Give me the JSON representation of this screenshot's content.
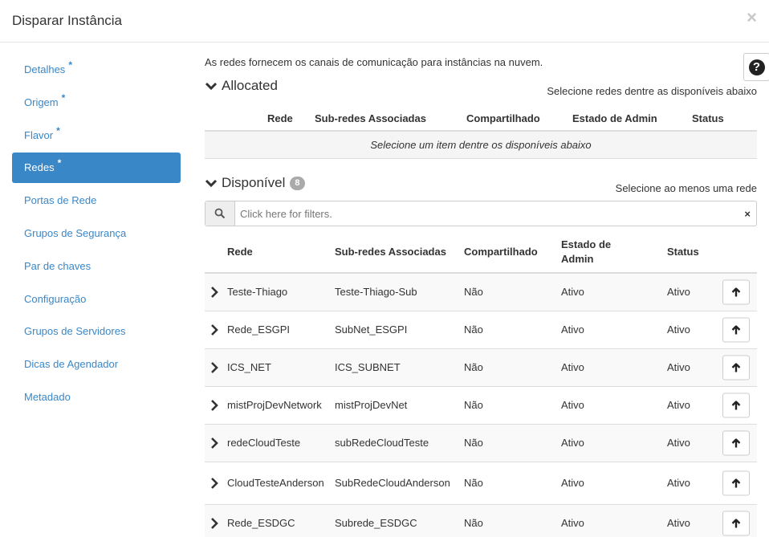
{
  "modal": {
    "title": "Disparar Instância",
    "close_icon": "×"
  },
  "sidebar": {
    "items": [
      {
        "label": "Detalhes",
        "required": "*"
      },
      {
        "label": "Origem",
        "required": "*"
      },
      {
        "label": "Flavor",
        "required": "*"
      },
      {
        "label": "Redes",
        "required": "*",
        "active": true
      },
      {
        "label": "Portas de Rede"
      },
      {
        "label": "Grupos de Segurança"
      },
      {
        "label": "Par de chaves"
      },
      {
        "label": "Configuração"
      },
      {
        "label": "Grupos de Servidores"
      },
      {
        "label": "Dicas de Agendador"
      },
      {
        "label": "Metadado"
      }
    ]
  },
  "content": {
    "help_text": "As redes fornecem os canais de comunicação para instâncias na nuvem.",
    "help_button": "?",
    "allocated": {
      "title": "Allocated",
      "hint": "Selecione redes dentre as disponíveis abaixo",
      "columns": [
        "Rede",
        "Sub-redes Associadas",
        "Compartilhado",
        "Estado de Admin",
        "Status"
      ],
      "empty_message": "Selecione um item dentre os disponíveis abaixo"
    },
    "available": {
      "title": "Disponível",
      "count": "8",
      "hint": "Selecione ao menos uma rede",
      "search_placeholder": "Click here for filters.",
      "clear_icon": "×",
      "columns": [
        "Rede",
        "Sub-redes Associadas",
        "Compartilhado",
        "Estado de\nAdmin",
        "Status"
      ],
      "rows": [
        {
          "rede": "Teste-Thiago",
          "subredes": "Teste-Thiago-Sub",
          "compartilhado": "Não",
          "estado": "Ativo",
          "status": "Ativo"
        },
        {
          "rede": "Rede_ESGPI",
          "subredes": "SubNet_ESGPI",
          "compartilhado": "Não",
          "estado": "Ativo",
          "status": "Ativo"
        },
        {
          "rede": "ICS_NET",
          "subredes": "ICS_SUBNET",
          "compartilhado": "Não",
          "estado": "Ativo",
          "status": "Ativo"
        },
        {
          "rede": "mistProjDevNetwork",
          "subredes": "mistProjDevNet",
          "compartilhado": "Não",
          "estado": "Ativo",
          "status": "Ativo"
        },
        {
          "rede": "redeCloudTeste",
          "subredes": "subRedeCloudTeste",
          "compartilhado": "Não",
          "estado": "Ativo",
          "status": "Ativo"
        },
        {
          "rede": "CloudTesteAnderson",
          "subredes": "SubRedeCloudAnderson",
          "compartilhado": "Não",
          "estado": "Ativo",
          "status": "Ativo"
        },
        {
          "rede": "Rede_ESDGC",
          "subredes": "Subrede_ESDGC",
          "compartilhado": "Não",
          "estado": "Ativo",
          "status": "Ativo"
        }
      ]
    }
  }
}
